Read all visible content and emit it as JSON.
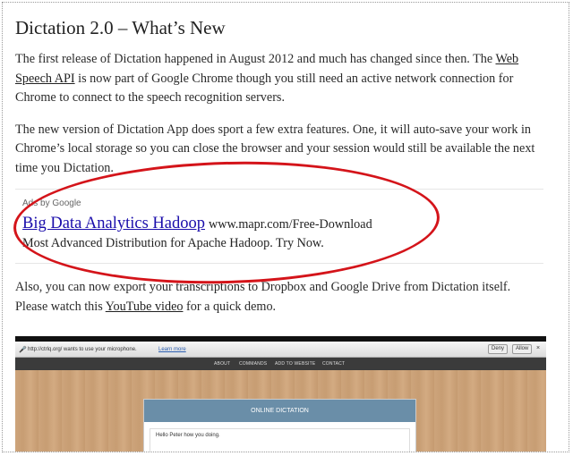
{
  "article": {
    "title": "Dictation 2.0 – What’s New",
    "p1": {
      "before": "The first release of Dictation happened in August 2012 and much has changed since then. The ",
      "link": "Web Speech API",
      "after": " is now part of Google Chrome though you still need an active network connection for Chrome to connect to the speech recognition servers."
    },
    "p2": "The new version of Dictation App does sport a few extra features. One, it will auto-save your work in Chrome’s local storage so you can close the browser and your session would still be available the next time you Dictation.",
    "p3": {
      "before": "Also, you can now export your transcriptions to Dropbox and Google Drive from Dictation itself. Please watch this ",
      "link": "YouTube video",
      "after": " for a quick demo."
    }
  },
  "ad": {
    "label": "Ads by Google",
    "title": "Big Data Analytics Hadoop",
    "url": "www.mapr.com/Free-Download",
    "description": "Most Advanced Distribution for Apache Hadoop. Try Now."
  },
  "annotation": {
    "color": "#d4141a"
  },
  "screenshot": {
    "infobar_text": "http://ctrlq.org/ wants to use your microphone.",
    "learn_more": "Learn more",
    "deny": "Deny",
    "allow": "Allow",
    "close": "×",
    "nav": [
      "ABOUT",
      "COMMANDS",
      "ADD TO WEBSITE",
      "CONTACT"
    ],
    "panel_title": "ONLINE DICTATION",
    "panel_text": "Hello Peter how you doing."
  }
}
